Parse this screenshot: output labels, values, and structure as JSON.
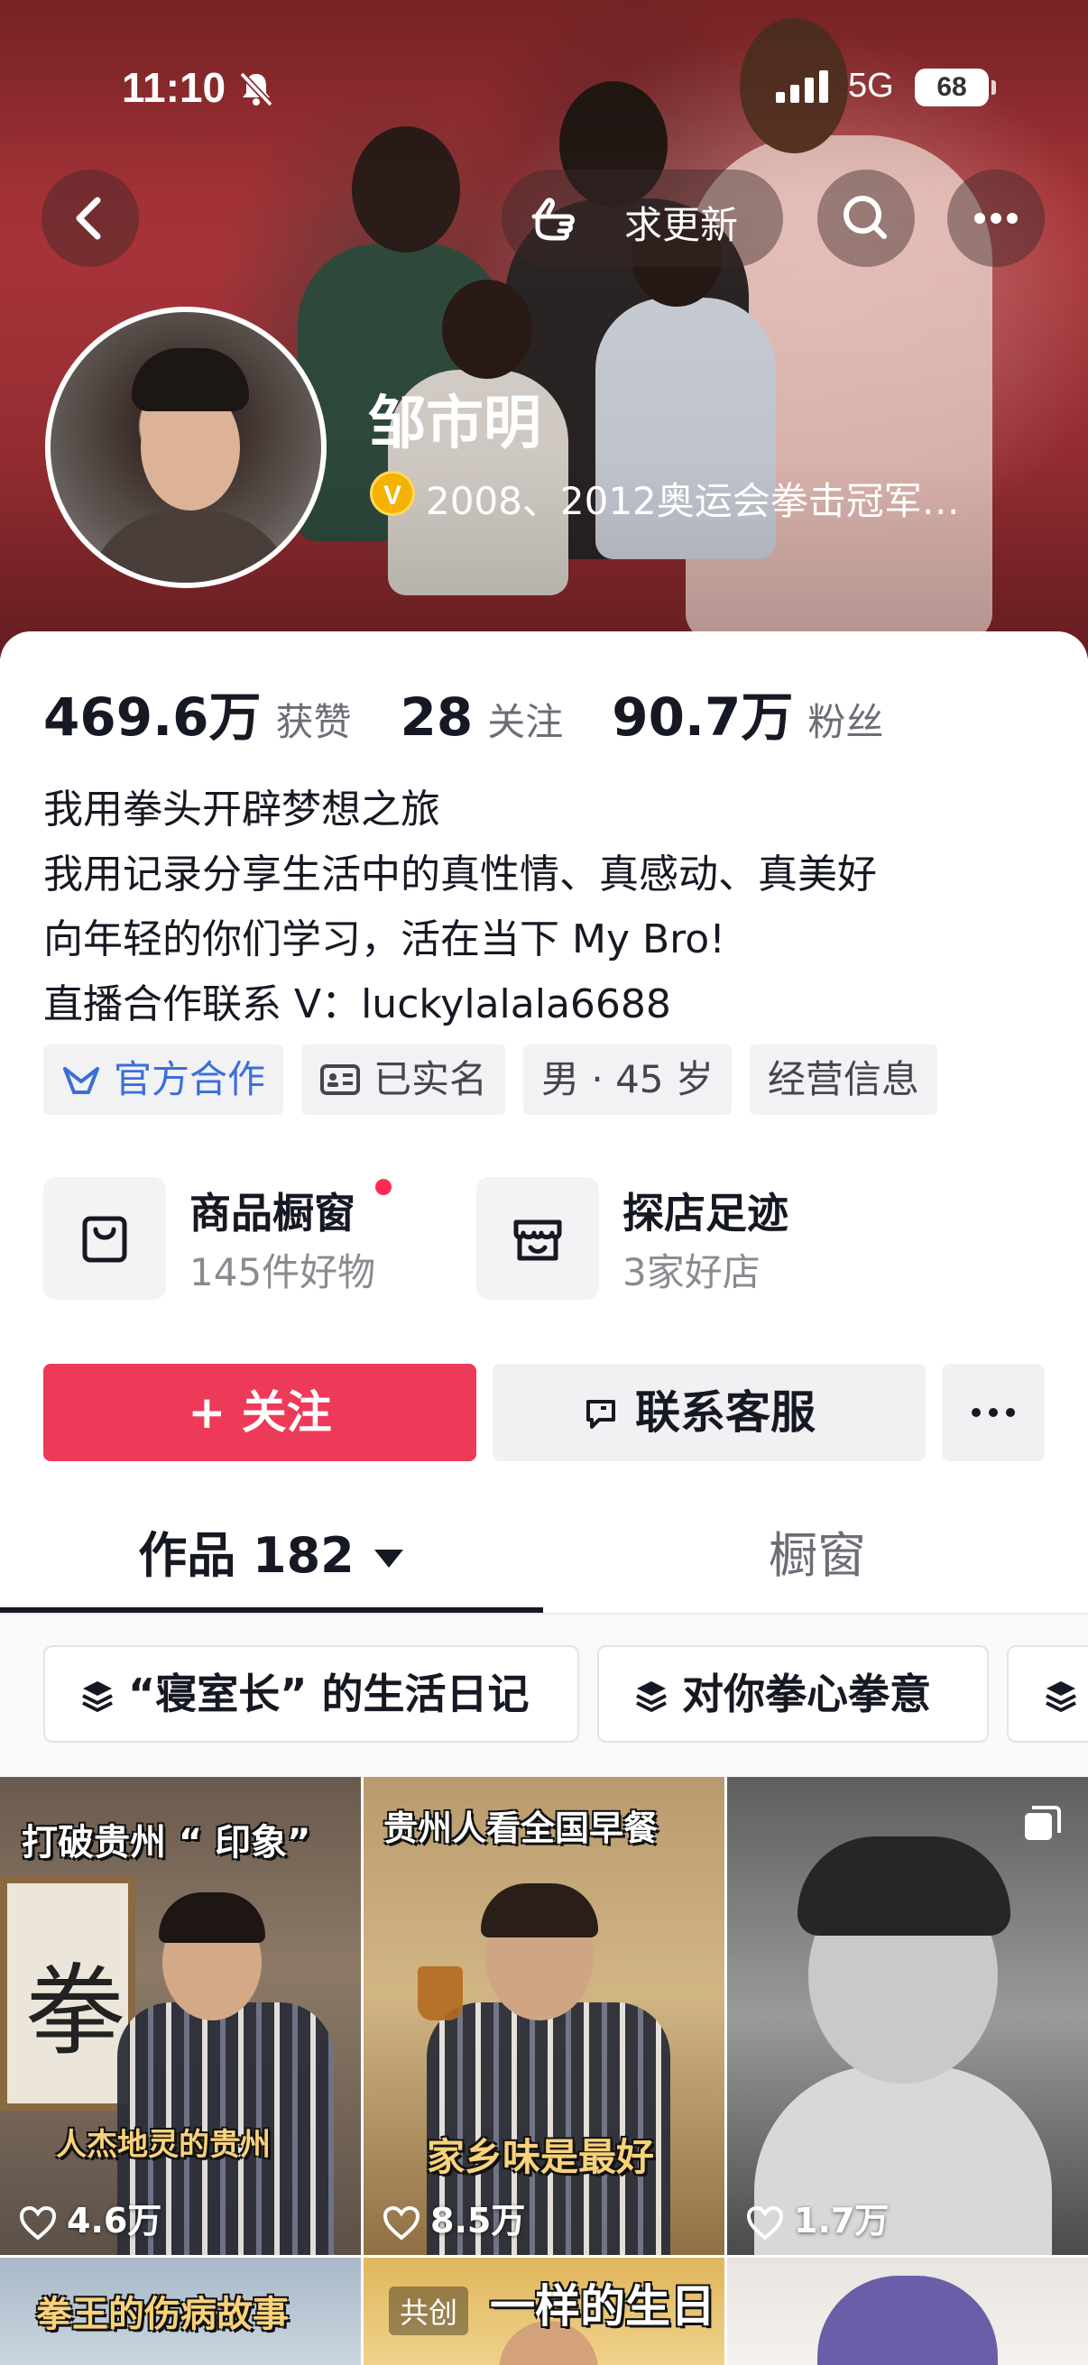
{
  "status_bar": {
    "time": "11:10",
    "network": "5G",
    "battery": "68"
  },
  "header": {
    "update_label": "求更新"
  },
  "profile": {
    "name": "邹市明",
    "verify_badge": "V",
    "verification": "2008、2012奥运会拳击冠军…",
    "stats": [
      {
        "value": "469.6万",
        "label": "获赞"
      },
      {
        "value": "28",
        "label": "关注"
      },
      {
        "value": "90.7万",
        "label": "粉丝"
      }
    ],
    "bio": [
      "我用拳头开辟梦想之旅",
      "我用记录分享生活中的真性情、真感动、真美好",
      "向年轻的你们学习，活在当下 My Bro!",
      "直播合作联系 V：luckylalala6688"
    ],
    "tags": [
      "官方合作",
      "已实名",
      "男 · 45 岁",
      "经营信息"
    ]
  },
  "shop": {
    "items": [
      {
        "title": "商品橱窗",
        "subtitle": "145件好物",
        "icon": "shopping-bag-icon"
      },
      {
        "title": "探店足迹",
        "subtitle": "3家好店",
        "icon": "store-icon"
      }
    ]
  },
  "actions": {
    "follow": "+ 关注",
    "service": "联系客服"
  },
  "tabs": {
    "works": "作品 182",
    "window": "橱窗"
  },
  "collections": [
    "“寝室长” 的生活日记",
    "对你拳心拳意"
  ],
  "videos": [
    {
      "likes": "4.6万",
      "caption_top": "打破贵州 “ 印象”",
      "caption_bottom": "人杰地灵的贵州",
      "calligraphy": "拳"
    },
    {
      "likes": "8.5万",
      "caption_top": "贵州人看全国早餐",
      "caption_bottom": "家乡味是最好"
    },
    {
      "likes": "1.7万"
    },
    {
      "caption_top": "拳王的伤病故事"
    },
    {
      "collab_badge": "共创",
      "caption_top": "一样的生日"
    },
    {}
  ],
  "colors": {
    "accent": "#ec3a58",
    "tag_blue": "#3a6fd8",
    "badge_gold": "#f3b300"
  }
}
